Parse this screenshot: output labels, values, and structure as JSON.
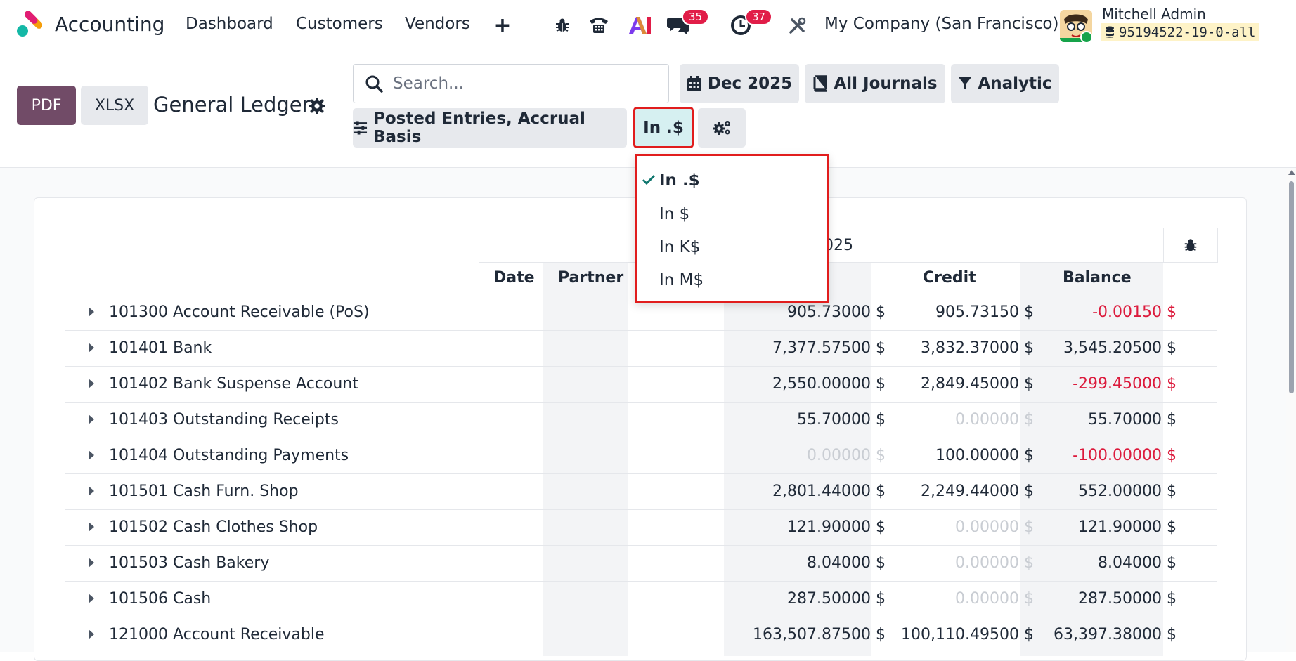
{
  "app": {
    "name": "Accounting",
    "menu": [
      "Dashboard",
      "Customers",
      "Vendors"
    ],
    "badges": {
      "messages": "35",
      "activities": "37"
    },
    "company": "My Company (San Francisco)",
    "user": {
      "name": "Mitchell Admin",
      "db": "95194522-19-0-all"
    }
  },
  "toolbar": {
    "pdf_label": "PDF",
    "xlsx_label": "XLSX",
    "title": "General Ledger",
    "search_placeholder": "Search...",
    "date_filter": "Dec 2025",
    "journals_filter": "All Journals",
    "analytic_filter": "Analytic",
    "entries_filter": "Posted Entries, Accrual Basis",
    "rounding_filter": "In .$"
  },
  "rounding_dropdown": {
    "options": [
      "In .$",
      "In $",
      "In K$",
      "In M$"
    ],
    "selected": "In .$"
  },
  "report": {
    "period_label": "025",
    "columns": {
      "date": "Date",
      "partner": "Partner",
      "credit": "Credit",
      "balance": "Balance"
    },
    "rows": [
      {
        "account": "101300 Account Receivable (PoS)",
        "debit": "905.73000 $",
        "credit": "905.73150 $",
        "balance": "-0.00150 $"
      },
      {
        "account": "101401 Bank",
        "debit": "7,377.57500 $",
        "credit": "3,832.37000 $",
        "balance": "3,545.20500 $"
      },
      {
        "account": "101402 Bank Suspense Account",
        "debit": "2,550.00000 $",
        "credit": "2,849.45000 $",
        "balance": "-299.45000 $"
      },
      {
        "account": "101403 Outstanding Receipts",
        "debit": "55.70000 $",
        "credit": "0.00000 $",
        "balance": "55.70000 $"
      },
      {
        "account": "101404 Outstanding Payments",
        "debit": "0.00000 $",
        "credit": "100.00000 $",
        "balance": "-100.00000 $"
      },
      {
        "account": "101501 Cash Furn. Shop",
        "debit": "2,801.44000 $",
        "credit": "2,249.44000 $",
        "balance": "552.00000 $"
      },
      {
        "account": "101502 Cash Clothes Shop",
        "debit": "121.90000 $",
        "credit": "0.00000 $",
        "balance": "121.90000 $"
      },
      {
        "account": "101503 Cash Bakery",
        "debit": "8.04000 $",
        "credit": "0.00000 $",
        "balance": "8.04000 $"
      },
      {
        "account": "101506 Cash",
        "debit": "287.50000 $",
        "credit": "0.00000 $",
        "balance": "287.50000 $"
      },
      {
        "account": "121000 Account Receivable",
        "debit": "163,507.87500 $",
        "credit": "100,110.49500 $",
        "balance": "63,397.38000 $"
      }
    ]
  },
  "colors": {
    "primary": "#714b67",
    "negative": "#dc1a3c",
    "highlight": "#e11d1d"
  },
  "icons": [
    "bug-icon",
    "phone-icon",
    "ai-icon",
    "chat-icon",
    "clock-icon",
    "tools-icon",
    "search-icon",
    "calendar-icon",
    "book-icon",
    "filter-icon",
    "sliders-icon",
    "cogs-icon",
    "gear-icon",
    "database-icon",
    "check-icon"
  ]
}
